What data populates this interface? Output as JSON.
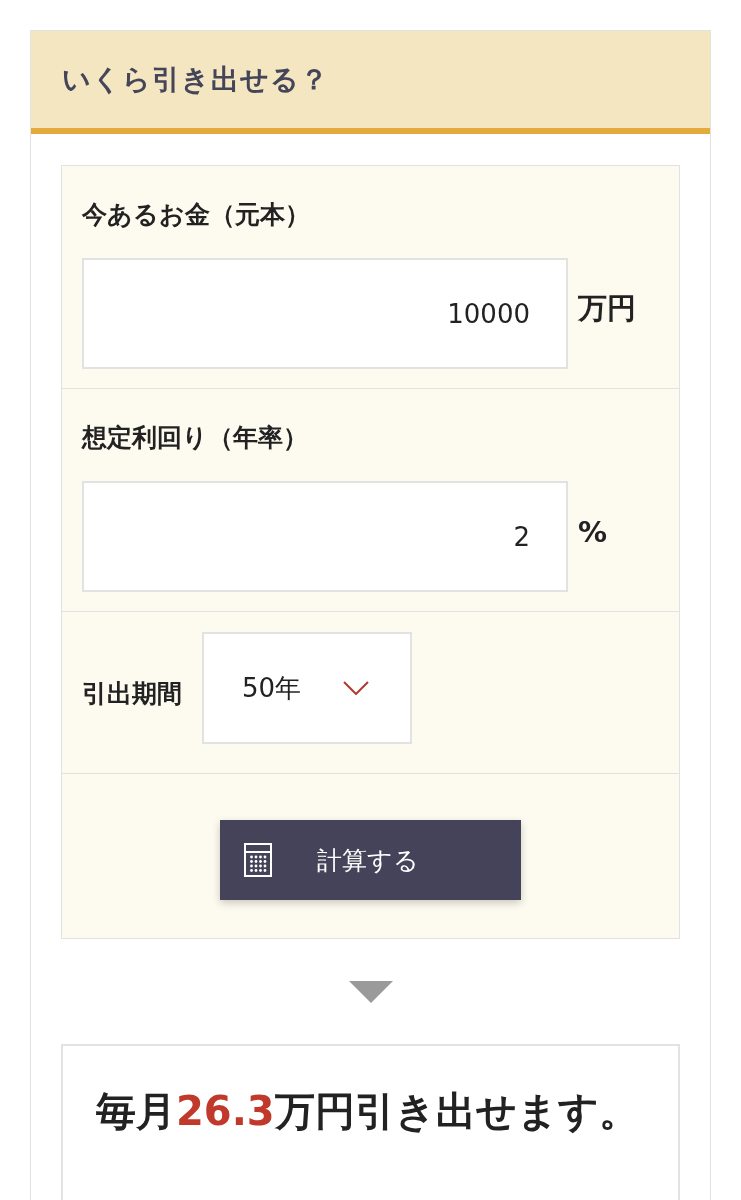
{
  "header": {
    "title": "いくら引き出せる？"
  },
  "fields": [
    {
      "kind": "input",
      "label": "今あるお金（元本）",
      "value": "10000",
      "unit": "万円"
    },
    {
      "kind": "input",
      "label": "想定利回り（年率）",
      "value": "2",
      "unit": "%"
    },
    {
      "kind": "select",
      "label": "引出期間",
      "value": "50年"
    }
  ],
  "calculate_button": {
    "label": "計算する"
  },
  "result": {
    "prefix": "毎月",
    "amount": "26.3",
    "suffix": "万円引き出せます。"
  }
}
